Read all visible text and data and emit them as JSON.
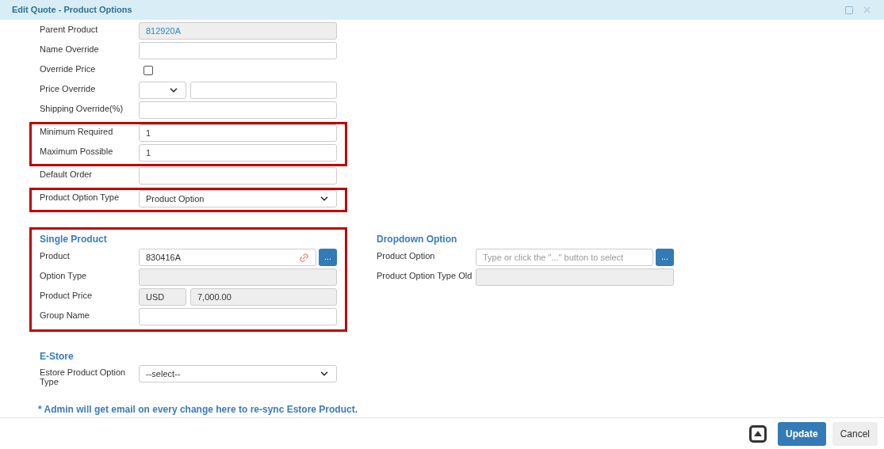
{
  "window": {
    "title": "Edit Quote - Product Options"
  },
  "groups": [
    {
      "highlighted": false,
      "fields": [
        {
          "kind": "link",
          "label": "Parent Product",
          "value": "812920A"
        },
        {
          "kind": "text",
          "label": "Name Override"
        },
        {
          "kind": "checkbox",
          "label": "Override Price",
          "checked": false
        },
        {
          "kind": "price_select",
          "label": "Price Override"
        },
        {
          "kind": "text",
          "label": "Shipping Override(%)"
        }
      ]
    },
    {
      "highlighted": true,
      "fields": [
        {
          "kind": "text",
          "label": "Minimum Required",
          "value": "1"
        },
        {
          "kind": "text",
          "label": "Maximum Possible",
          "value": "1"
        }
      ]
    },
    {
      "highlighted": false,
      "fields": [
        {
          "kind": "text",
          "label": "Default Order"
        }
      ]
    },
    {
      "highlighted": true,
      "fields": [
        {
          "kind": "select",
          "label": "Product Option Type",
          "value": "Product Option"
        }
      ]
    }
  ],
  "sections": [
    {
      "title": "Single Product",
      "highlighted": true,
      "fields": [
        {
          "kind": "lookup",
          "label": "Product",
          "value": "830416A",
          "button": "..."
        },
        {
          "kind": "readonly",
          "label": "Option Type"
        },
        {
          "kind": "currency",
          "label": "Product Price",
          "currency": "USD",
          "value": "7,000.00"
        },
        {
          "kind": "text",
          "label": "Group Name"
        }
      ]
    },
    {
      "title": "Dropdown Option",
      "highlighted": false,
      "fields": [
        {
          "kind": "lookup",
          "label": "Product Option",
          "placeholder": "Type or click the \"...\" button to select",
          "button": "..."
        },
        {
          "kind": "readonly",
          "label": "Product Option Type Old"
        }
      ]
    }
  ],
  "estore": {
    "title": "E-Store",
    "fields": [
      {
        "kind": "select",
        "label": "Estore Product Option Type",
        "value": "--select--"
      }
    ]
  },
  "note": "* Admin will get email on every change here to re-sync Estore Product.",
  "buttons": [
    {
      "label": "Update",
      "kind": "primary"
    },
    {
      "label": "Cancel",
      "kind": "secondary"
    }
  ]
}
